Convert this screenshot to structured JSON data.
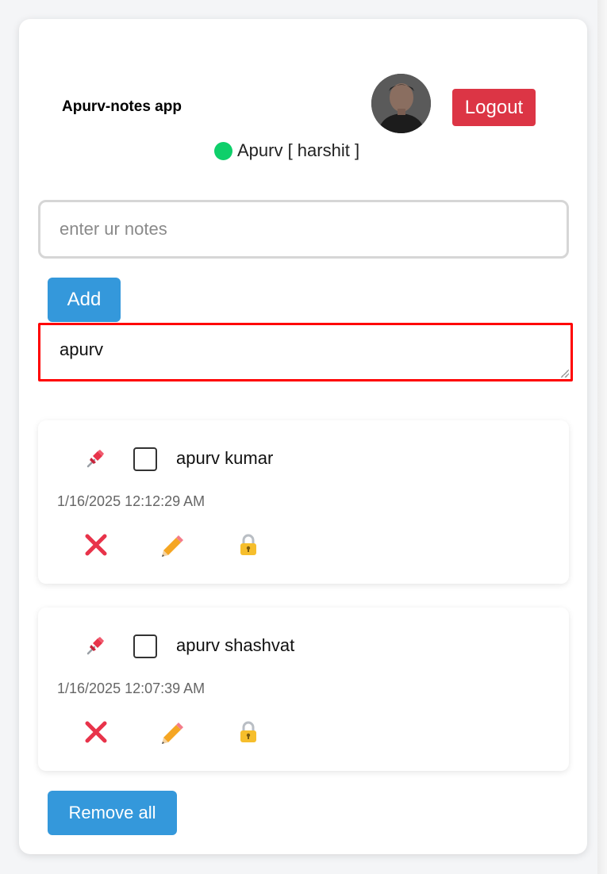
{
  "app": {
    "title": "Apurv-notes app",
    "logout_label": "Logout",
    "user_display": "Apurv [ harshit ]",
    "status": "online",
    "avatar_icon": "user-photo"
  },
  "note_input": {
    "placeholder": "enter ur notes",
    "value": ""
  },
  "add_label": "Add",
  "search": {
    "value": "apurv"
  },
  "notes": [
    {
      "text": "apurv kumar",
      "timestamp": "1/16/2025 12:12:29 AM",
      "checked": false,
      "icons": [
        "pin-icon",
        "delete-icon",
        "edit-icon",
        "lock-icon"
      ]
    },
    {
      "text": "apurv shashvat",
      "timestamp": "1/16/2025 12:07:39 AM",
      "checked": false,
      "icons": [
        "pin-icon",
        "delete-icon",
        "edit-icon",
        "lock-icon"
      ]
    }
  ],
  "remove_all_label": "Remove all",
  "colors": {
    "logout": "#dc3545",
    "primary": "#3498db",
    "online": "#0ecf6a",
    "search_border": "#ff0000"
  }
}
